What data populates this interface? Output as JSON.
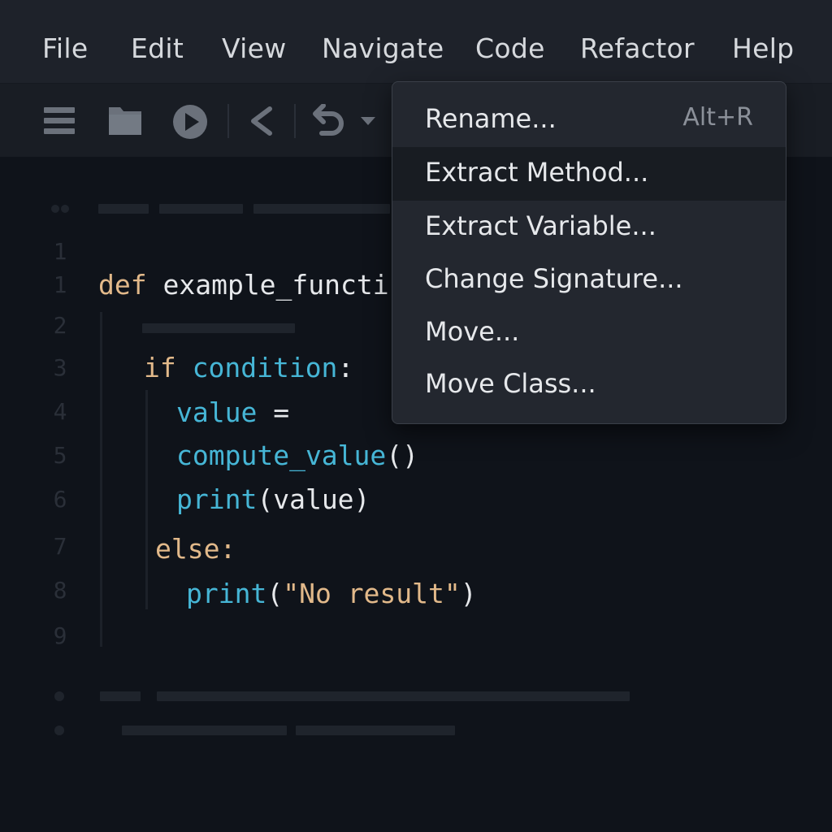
{
  "menubar": {
    "items": [
      {
        "label": "File"
      },
      {
        "label": "Edit"
      },
      {
        "label": "View"
      },
      {
        "label": "Navigate"
      },
      {
        "label": "Code"
      },
      {
        "label": "Refactor"
      },
      {
        "label": "Help"
      }
    ]
  },
  "toolbar": {
    "icons": [
      "menu-icon",
      "folder-icon",
      "run-icon",
      "back-icon",
      "undo-icon",
      "dropdown-arrow-icon"
    ]
  },
  "editor": {
    "line_numbers": [
      "1",
      "1",
      "2",
      "3",
      "4",
      "5",
      "6",
      "7",
      "8",
      "9"
    ],
    "code": {
      "line1_kw": "def",
      "line1_rest": " example_functi",
      "line2_kw": "if",
      "line2_cond": " condition",
      "line2_colon": ":",
      "line3_var": "value",
      "line3_op": " =",
      "line4_fn": "compute_value",
      "line4_paren": "()",
      "line5_fn": "print",
      "line5_args": "(value)",
      "line6_kw": "else:",
      "line7_fn": "print",
      "line7_open": "(",
      "line7_str": "\"No result\"",
      "line7_close": ")"
    }
  },
  "refactor_menu": {
    "items": [
      {
        "label": "Rename...",
        "shortcut": "Alt+R"
      },
      {
        "label": "Extract Method...",
        "shortcut": ""
      },
      {
        "label": "Extract Variable...",
        "shortcut": ""
      },
      {
        "label": "Change Signature...",
        "shortcut": ""
      },
      {
        "label": "Move...",
        "shortcut": ""
      },
      {
        "label": "Move Class...",
        "shortcut": ""
      }
    ],
    "highlighted_index": 1
  },
  "colors": {
    "keyword": "#e2b98a",
    "function": "#46b6d6",
    "background": "#0f131a",
    "menubar": "#1e222a"
  }
}
